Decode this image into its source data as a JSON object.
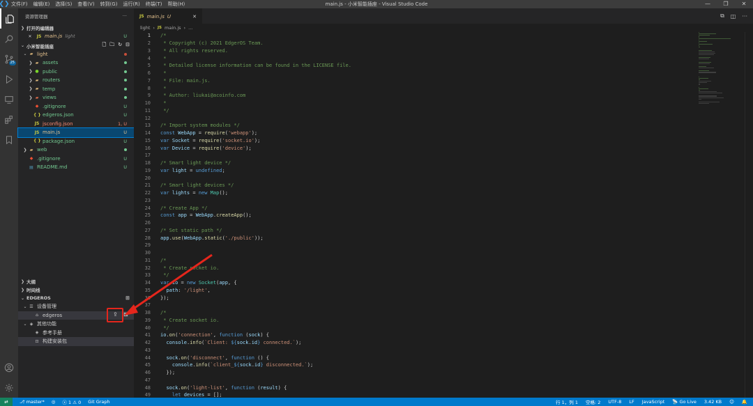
{
  "titlebar": {
    "menu": [
      "文件(F)",
      "编辑(E)",
      "选择(S)",
      "查看(V)",
      "转到(G)",
      "运行(R)",
      "终端(T)",
      "帮助(H)"
    ],
    "title": "main.js - 小米智能插座 - Visual Studio Code"
  },
  "activity": {
    "scm_badge": "25"
  },
  "sidebar": {
    "header": "资源管理器",
    "open_editors": {
      "title": "打开的编辑器",
      "item": {
        "name": "main.js",
        "path": "light",
        "status": "U"
      }
    },
    "workspace": {
      "title": "小米智能插座"
    },
    "tree": [
      {
        "name": "light",
        "kind": "folder-open",
        "depth": 0,
        "status": "",
        "dot": "#c74e39"
      },
      {
        "name": "assets",
        "kind": "folder",
        "depth": 1,
        "status": "",
        "dot": "#73c991"
      },
      {
        "name": "public",
        "kind": "folder-special",
        "depth": 1,
        "status": "",
        "dot": "#73c991"
      },
      {
        "name": "routers",
        "kind": "folder",
        "depth": 1,
        "status": "",
        "dot": "#73c991"
      },
      {
        "name": "temp",
        "kind": "folder",
        "depth": 1,
        "status": "",
        "dot": "#73c991"
      },
      {
        "name": "views",
        "kind": "folder-views",
        "depth": 1,
        "status": "",
        "dot": "#73c991"
      },
      {
        "name": ".gitignore",
        "kind": "git",
        "depth": 1,
        "status": "U",
        "color": "#73c991"
      },
      {
        "name": "edgeros.json",
        "kind": "json",
        "depth": 1,
        "status": "U",
        "color": "#73c991"
      },
      {
        "name": "jsconfig.json",
        "kind": "jsconfig",
        "depth": 1,
        "status": "1, U",
        "color": "#f48771"
      },
      {
        "name": "main.js",
        "kind": "js",
        "depth": 1,
        "status": "U",
        "color": "#e2c08d",
        "selected": true
      },
      {
        "name": "package.json",
        "kind": "json",
        "depth": 1,
        "status": "U",
        "color": "#73c991"
      },
      {
        "name": "web",
        "kind": "folder",
        "depth": 0,
        "status": "",
        "dot": "#73c991"
      },
      {
        "name": ".gitignore",
        "kind": "git",
        "depth": 0,
        "status": "U",
        "color": "#73c991"
      },
      {
        "name": "README.md",
        "kind": "md",
        "depth": 0,
        "status": "U",
        "color": "#73c991"
      }
    ],
    "outline": "大纲",
    "timeline": "时间线",
    "edgeros": {
      "title": "EDGEROS",
      "device_mgmt": "设备管理",
      "device": "edgeros",
      "other": "其他功能",
      "manual": "参考手册",
      "build": "构建安装包"
    }
  },
  "editor": {
    "tab": {
      "name": "main.js",
      "status": "U"
    },
    "breadcrumbs": [
      "light",
      "main.js",
      "..."
    ],
    "lines": [
      [
        [
          "c",
          "/*"
        ]
      ],
      [
        [
          "c",
          " * Copyright (c) 2021 EdgerOS Team."
        ]
      ],
      [
        [
          "c",
          " * All rights reserved."
        ]
      ],
      [
        [
          "c",
          " *"
        ]
      ],
      [
        [
          "c",
          " * Detailed license information can be found in the LICENSE file."
        ]
      ],
      [
        [
          "c",
          " *"
        ]
      ],
      [
        [
          "c",
          " * File: main.js."
        ]
      ],
      [
        [
          "c",
          " *"
        ]
      ],
      [
        [
          "c",
          " * Author: liukai@acoinfo.com"
        ]
      ],
      [
        [
          "c",
          " *"
        ]
      ],
      [
        [
          "c",
          " */"
        ]
      ],
      [],
      [
        [
          "c",
          "/* Import system modules */"
        ]
      ],
      [
        [
          "k",
          "const "
        ],
        [
          "v",
          "WebApp"
        ],
        [
          "w",
          " = "
        ],
        [
          "f",
          "require"
        ],
        [
          "w",
          "("
        ],
        [
          "s",
          "'webapp'"
        ],
        [
          "w",
          ");"
        ]
      ],
      [
        [
          "k",
          "var "
        ],
        [
          "v",
          "Socket"
        ],
        [
          "w",
          " = "
        ],
        [
          "f",
          "require"
        ],
        [
          "w",
          "("
        ],
        [
          "s",
          "'socket.io'"
        ],
        [
          "w",
          ");"
        ]
      ],
      [
        [
          "k",
          "var "
        ],
        [
          "v",
          "Device"
        ],
        [
          "w",
          " = "
        ],
        [
          "f",
          "require"
        ],
        [
          "w",
          "("
        ],
        [
          "s",
          "'device'"
        ],
        [
          "w",
          ");"
        ]
      ],
      [],
      [
        [
          "c",
          "/* Smart light device */"
        ]
      ],
      [
        [
          "k",
          "var "
        ],
        [
          "v",
          "light"
        ],
        [
          "w",
          " = "
        ],
        [
          "k",
          "undefined"
        ],
        [
          "w",
          ";"
        ]
      ],
      [],
      [
        [
          "c",
          "/* Smart light devices */"
        ]
      ],
      [
        [
          "k",
          "var "
        ],
        [
          "v",
          "lights"
        ],
        [
          "w",
          " = "
        ],
        [
          "k",
          "new "
        ],
        [
          "t",
          "Map"
        ],
        [
          "w",
          "();"
        ]
      ],
      [],
      [
        [
          "c",
          "/* Create App */"
        ]
      ],
      [
        [
          "k",
          "const "
        ],
        [
          "v",
          "app"
        ],
        [
          "w",
          " = "
        ],
        [
          "v",
          "WebApp"
        ],
        [
          "w",
          "."
        ],
        [
          "f",
          "createApp"
        ],
        [
          "w",
          "();"
        ]
      ],
      [],
      [
        [
          "c",
          "/* Set static path */"
        ]
      ],
      [
        [
          "v",
          "app"
        ],
        [
          "w",
          "."
        ],
        [
          "f",
          "use"
        ],
        [
          "w",
          "("
        ],
        [
          "v",
          "WebApp"
        ],
        [
          "w",
          "."
        ],
        [
          "f",
          "static"
        ],
        [
          "w",
          "("
        ],
        [
          "s",
          "'./public'"
        ],
        [
          "w",
          "));"
        ]
      ],
      [],
      [],
      [
        [
          "c",
          "/*"
        ]
      ],
      [
        [
          "c",
          " * Create socket io."
        ]
      ],
      [
        [
          "c",
          " */"
        ]
      ],
      [
        [
          "k",
          "var "
        ],
        [
          "v",
          "io"
        ],
        [
          "w",
          " = "
        ],
        [
          "k",
          "new "
        ],
        [
          "t",
          "Socket"
        ],
        [
          "w",
          "("
        ],
        [
          "v",
          "app"
        ],
        [
          "w",
          ", {"
        ]
      ],
      [
        [
          "w",
          "  "
        ],
        [
          "v",
          "path"
        ],
        [
          "w",
          ": "
        ],
        [
          "s",
          "'/light'"
        ],
        [
          "w",
          ","
        ]
      ],
      [
        [
          "w",
          "});"
        ]
      ],
      [],
      [
        [
          "c",
          "/*"
        ]
      ],
      [
        [
          "c",
          " * Create socket io."
        ]
      ],
      [
        [
          "c",
          " */"
        ]
      ],
      [
        [
          "v",
          "io"
        ],
        [
          "w",
          "."
        ],
        [
          "f",
          "on"
        ],
        [
          "w",
          "("
        ],
        [
          "s",
          "'connection'"
        ],
        [
          "w",
          ", "
        ],
        [
          "k",
          "function "
        ],
        [
          "w",
          "("
        ],
        [
          "v",
          "sock"
        ],
        [
          "w",
          ") {"
        ]
      ],
      [
        [
          "w",
          "  "
        ],
        [
          "v",
          "console"
        ],
        [
          "w",
          "."
        ],
        [
          "f",
          "info"
        ],
        [
          "w",
          "("
        ],
        [
          "s",
          "`Client: "
        ],
        [
          "k",
          "${"
        ],
        [
          "v",
          "sock"
        ],
        [
          "w",
          "."
        ],
        [
          "v",
          "id"
        ],
        [
          "k",
          "}"
        ],
        [
          "s",
          " connected.`"
        ],
        [
          "w",
          ");"
        ]
      ],
      [],
      [
        [
          "w",
          "  "
        ],
        [
          "v",
          "sock"
        ],
        [
          "w",
          "."
        ],
        [
          "f",
          "on"
        ],
        [
          "w",
          "("
        ],
        [
          "s",
          "'disconnect'"
        ],
        [
          "w",
          ", "
        ],
        [
          "k",
          "function "
        ],
        [
          "w",
          "() {"
        ]
      ],
      [
        [
          "w",
          "    "
        ],
        [
          "v",
          "console"
        ],
        [
          "w",
          "."
        ],
        [
          "f",
          "info"
        ],
        [
          "w",
          "("
        ],
        [
          "s",
          "`client_"
        ],
        [
          "k",
          "${"
        ],
        [
          "v",
          "sock"
        ],
        [
          "w",
          "."
        ],
        [
          "v",
          "id"
        ],
        [
          "k",
          "}"
        ],
        [
          "s",
          " disconnected.`"
        ],
        [
          "w",
          ");"
        ]
      ],
      [
        [
          "w",
          "  });"
        ]
      ],
      [],
      [
        [
          "w",
          "  "
        ],
        [
          "v",
          "sock"
        ],
        [
          "w",
          "."
        ],
        [
          "f",
          "on"
        ],
        [
          "w",
          "("
        ],
        [
          "s",
          "'light-list'"
        ],
        [
          "w",
          ", "
        ],
        [
          "k",
          "function "
        ],
        [
          "w",
          "("
        ],
        [
          "v",
          "result"
        ],
        [
          "w",
          ") {"
        ]
      ],
      [
        [
          "w",
          "    "
        ],
        [
          "k",
          "let "
        ],
        [
          "v",
          "devices"
        ],
        [
          "w",
          " = [];"
        ]
      ]
    ]
  },
  "statusbar": {
    "branch": "master*",
    "problems": "1",
    "warnings": "0",
    "gitgraph": "Git Graph",
    "position": "行 1，列 1",
    "spaces": "空格: 2",
    "encoding": "UTF-8",
    "eol": "LF",
    "language": "JavaScript",
    "golive": "Go Live",
    "filesize": "3.42 KB"
  },
  "colors": {
    "accent": "#007acc",
    "highlight": "#e5261c",
    "selection": "#094771"
  }
}
